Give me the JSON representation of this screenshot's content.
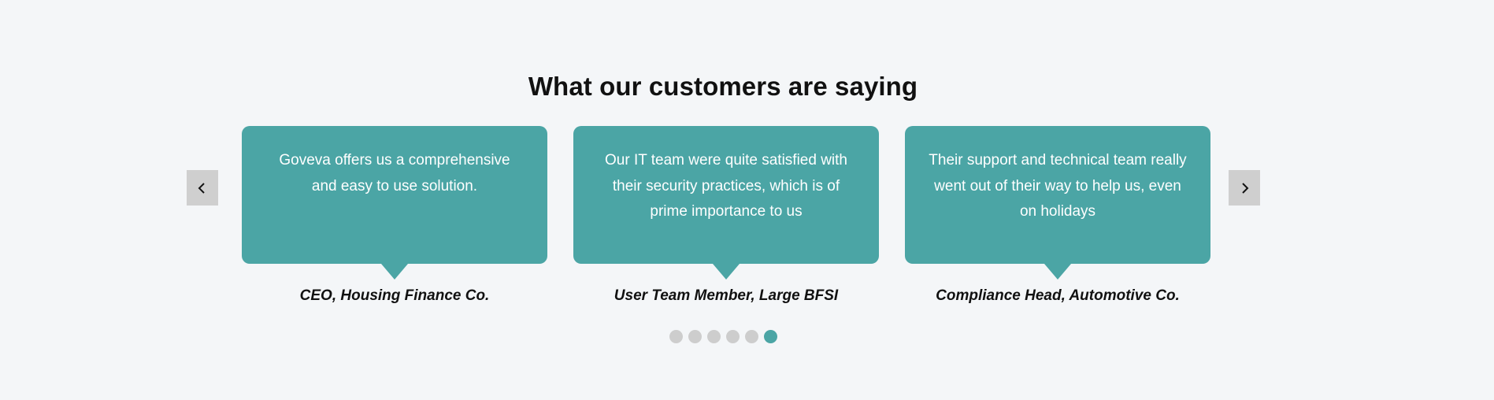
{
  "section": {
    "title": "What our customers are saying"
  },
  "carousel": {
    "prev_icon": "chevron-left-icon",
    "next_icon": "chevron-right-icon",
    "testimonials": [
      {
        "quote": "Goveva offers us a comprehensive and easy to use solution.",
        "author": "CEO, Housing Finance Co."
      },
      {
        "quote": "Our IT team were quite satisfied with their security practices, which is of prime importance to us",
        "author": "User Team Member, Large BFSI"
      },
      {
        "quote": "Their support and technical team really went out of their way to help us, even on holidays",
        "author": "Compliance Head, Automotive Co."
      }
    ],
    "pagination": {
      "total": 6,
      "active_index": 5
    }
  },
  "colors": {
    "accent": "#4ba5a5",
    "background": "#f4f6f8",
    "inactive_dot": "#cdcdcd",
    "nav_button": "#cfcfcf"
  }
}
